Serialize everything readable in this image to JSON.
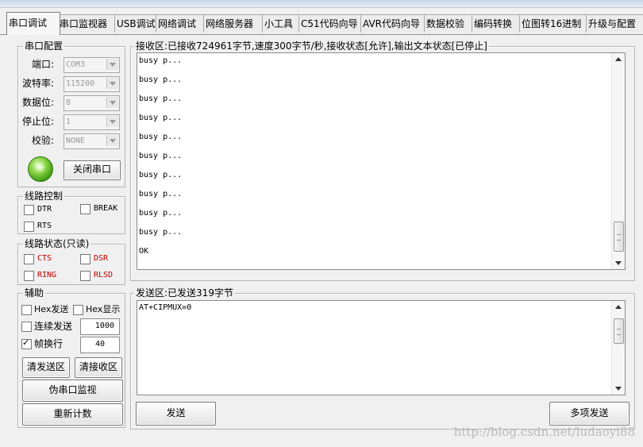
{
  "tabs": [
    "串口调试",
    "串口监视器",
    "USB调试",
    "网络调试",
    "网络服务器",
    "小工具",
    "C51代码向导",
    "AVR代码向导",
    "数据校验",
    "编码转换",
    "位图转16进制",
    "升级与配置"
  ],
  "serial_config": {
    "title": "串口配置",
    "port_label": "端口:",
    "port_value": "COM3",
    "baud_label": "波特率:",
    "baud_value": "115200",
    "databits_label": "数据位:",
    "databits_value": "8",
    "stopbits_label": "停止位:",
    "stopbits_value": "1",
    "parity_label": "校验:",
    "parity_value": "NONE",
    "status_icon": "green-led-icon",
    "close_button": "关闭串口"
  },
  "line_control": {
    "title": "线路控制",
    "dtr": "DTR",
    "brk": "BREAK",
    "rts": "RTS"
  },
  "line_status": {
    "title": "线路状态(只读)",
    "cts": "CTS",
    "dsr": "DSR",
    "ring": "RING",
    "rlsd": "RLSD",
    "color": "#c00000"
  },
  "assist": {
    "title": "辅助",
    "hex_send": "Hex发送",
    "hex_show": "Hex显示",
    "continuous_send": "连续发送",
    "interval": "1000",
    "frame_newline": "帧换行",
    "frame_value": "40",
    "clear_send": "清发送区",
    "clear_recv": "清接收区",
    "pseudo_monitor": "伪串口监视",
    "recount": "重新计数"
  },
  "receive": {
    "title": "接收区:已接收724961字节,速度300字节/秒,接收状态[允许],输出文本状态[已停止]",
    "lines": [
      "busy p...",
      "busy p...",
      "busy p...",
      "busy p...",
      "busy p...",
      "busy p...",
      "busy p...",
      "busy p...",
      "busy p...",
      "busy p...",
      "OK"
    ]
  },
  "send": {
    "title": "发送区:已发送319字节",
    "content": "AT+CIPMUX=0",
    "send_button": "发送",
    "multi_send_button": "多项发送"
  },
  "watermark": "http://blog.csdn.net/ludaoyi88"
}
